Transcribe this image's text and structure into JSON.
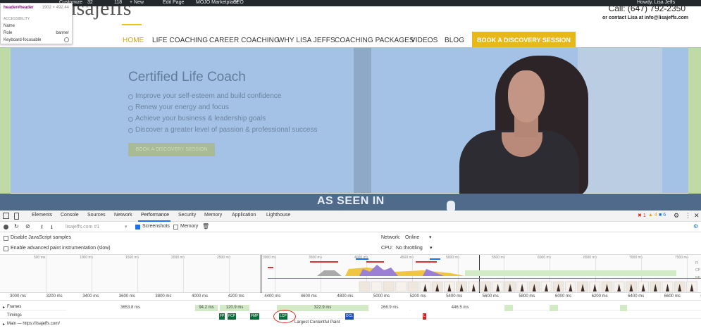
{
  "admin_bar": {
    "items": [
      "Customize",
      "32",
      "118",
      "+ New",
      "Edit Page",
      "MOJO Marketplace",
      "SEO"
    ],
    "howdy": "Howdy, Lisa Jeffs"
  },
  "site": {
    "logo": "lisajeffs",
    "call": "Call: (647) 792-2350",
    "contact": "or contact Lisa at info@lisajeffs.com",
    "nav": [
      "HOME",
      "LIFE COACHING",
      "CAREER COACHING",
      "WHY LISA JEFFS",
      "COACHING PACKAGES",
      "VIDEOS",
      "BLOG"
    ],
    "nav_cta": "BOOK A DISCOVERY SESSION",
    "hero": {
      "title": "Certified Life Coach",
      "bullets": [
        "Improve your self-esteem and build confidence",
        "Renew your energy and focus",
        "Achieve your business & leadership goals",
        "Discover a greater level of passion & professional success"
      ],
      "button": "BOOK A DISCOVERY SESSION"
    },
    "seen_in": "AS SEEN IN"
  },
  "inspector_tooltip": {
    "selector": "header#header",
    "size": "1902 × 492.44",
    "section": "ACCESSIBILITY",
    "rows": [
      {
        "k": "Name",
        "v": ""
      },
      {
        "k": "Role",
        "v": "banner"
      },
      {
        "k": "Keyboard-focusable",
        "v": ""
      }
    ]
  },
  "devtools": {
    "tabs": [
      "Elements",
      "Console",
      "Sources",
      "Network",
      "Performance",
      "Security",
      "Memory",
      "Application",
      "Lighthouse"
    ],
    "active_tab": "Performance",
    "badges": {
      "errors": "1",
      "warnings": "4",
      "info": "6"
    },
    "recording": "lisajeffs.com #1",
    "screenshots_label": "Screenshots",
    "memory_label": "Memory",
    "disable_js": "Disable JavaScript samples",
    "advanced_paint": "Enable advanced paint instrumentation (slow)",
    "network_label": "Network:",
    "network_value": "Online",
    "cpu_label": "CPU:",
    "cpu_value": "No throttling",
    "overview_ticks": [
      "500 ms",
      "1000 ms",
      "1500 ms",
      "2000 ms",
      "2500 ms",
      "3000 ms",
      "3500 ms",
      "4000 ms",
      "4500 ms",
      "5000 ms",
      "5500 ms",
      "6000 ms",
      "6500 ms",
      "7000 ms",
      "7500 ms"
    ],
    "overview_side": [
      "FI",
      "CP",
      "NE"
    ],
    "axis_ticks": [
      "3000 ms",
      "3200 ms",
      "3400 ms",
      "3600 ms",
      "3800 ms",
      "4000 ms",
      "4200 ms",
      "4400 ms",
      "4600 ms",
      "4800 ms",
      "5000 ms",
      "5200 ms",
      "5400 ms",
      "5600 ms",
      "5800 ms",
      "6000 ms",
      "6200 ms",
      "6400 ms",
      "6600 ms",
      "680"
    ],
    "frames_label": "Frames",
    "frames": [
      "3653.8 ms",
      "94.2 ms",
      "120.9 ms",
      "322.9 ms",
      "266.9 ms",
      "446.5 ms"
    ],
    "timings_label": "Timings",
    "timing_markers": [
      "FP",
      "FCP",
      "FMP",
      "LCP",
      "DCL",
      "L"
    ],
    "lcp_tooltip": "Largest Contentful Paint",
    "main_label": "Main — https://lisajeffs.com/"
  }
}
